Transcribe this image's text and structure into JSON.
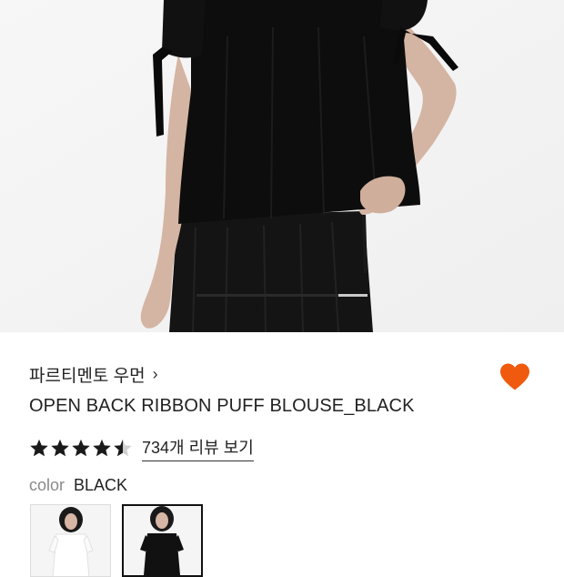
{
  "product": {
    "brand": "파르티멘토 우먼",
    "brand_chevron": "›",
    "title": "OPEN BACK RIBBON PUFF BLOUSE_BLACK",
    "rating": 4.5,
    "rating_max": 5,
    "review_link": "734개 리뷰 보기",
    "color_label": "color",
    "color_value": "BLACK",
    "favorited": true
  },
  "gallery": {
    "progress": 0.83
  },
  "colors": {
    "heart": "#f05a0e",
    "star": "#1a1a1a",
    "text_muted": "#8a8a8a"
  },
  "icons": {
    "favorite": "heart-icon",
    "rating": "star-icon",
    "brand_link": "chevron-right-icon"
  }
}
